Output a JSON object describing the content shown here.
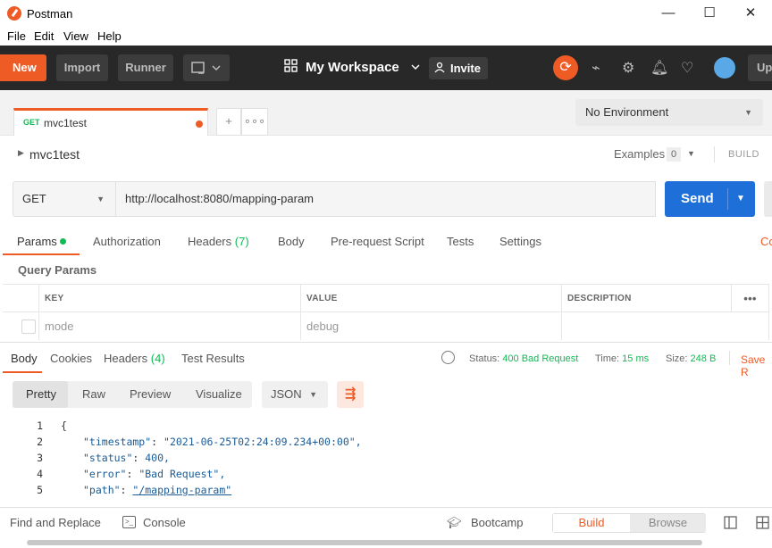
{
  "window": {
    "title": "Postman",
    "minimize": "—",
    "maximize": "☐",
    "close": "✕"
  },
  "menu": [
    "File",
    "Edit",
    "View",
    "Help"
  ],
  "header": {
    "new_label": "New",
    "import_label": "Import",
    "runner_label": "Runner",
    "workspace_label": "My Workspace",
    "invite_label": "Invite",
    "upgrade_label": "Up"
  },
  "request_tab": {
    "method": "GET",
    "name": "mvc1test"
  },
  "environment": {
    "selected": "No Environment"
  },
  "request_name": "mvc1test",
  "examples": {
    "label": "Examples",
    "count": "0"
  },
  "build_label": "BUILD",
  "request": {
    "method": "GET",
    "url": "http://localhost:8080/mapping-param",
    "send_label": "Send"
  },
  "request_tabs": {
    "params": "Params",
    "authorization": "Authorization",
    "headers": "Headers",
    "headers_count": "(7)",
    "body": "Body",
    "prerequest": "Pre-request Script",
    "tests": "Tests",
    "settings": "Settings",
    "cookies_cut": "Co"
  },
  "query_params": {
    "title": "Query Params",
    "columns": {
      "key": "KEY",
      "value": "VALUE",
      "description": "DESCRIPTION"
    },
    "row": {
      "key": "mode",
      "value": "debug",
      "description": ""
    }
  },
  "response_tabs": {
    "body": "Body",
    "cookies": "Cookies",
    "headers": "Headers",
    "headers_count": "(4)",
    "test_results": "Test Results"
  },
  "response_status": {
    "status_label": "Status:",
    "status_value": "400 Bad Request",
    "time_label": "Time:",
    "time_value": "15 ms",
    "size_label": "Size:",
    "size_value": "248 B",
    "save_label": "Save R"
  },
  "format_tabs": {
    "pretty": "Pretty",
    "raw": "Raw",
    "preview": "Preview",
    "visualize": "Visualize",
    "format": "JSON"
  },
  "code_lines": [
    {
      "num": "1",
      "text": "{"
    },
    {
      "num": "2",
      "key": "\"timestamp\"",
      "value": "\"2021-06-25T02:24:09.234+00:00\","
    },
    {
      "num": "3",
      "key": "\"status\"",
      "value": "400,"
    },
    {
      "num": "4",
      "key": "\"error\"",
      "value": "\"Bad Request\","
    },
    {
      "num": "5",
      "key": "\"path\"",
      "value": "\"/mapping-param\""
    }
  ],
  "statusbar": {
    "find_replace": "Find and Replace",
    "console": "Console",
    "bootcamp": "Bootcamp",
    "build": "Build",
    "browse": "Browse"
  },
  "colors": {
    "accent": "#ef5b25",
    "send": "#1f6fd9",
    "success": "#0cbb52",
    "header_bg": "#282828"
  }
}
